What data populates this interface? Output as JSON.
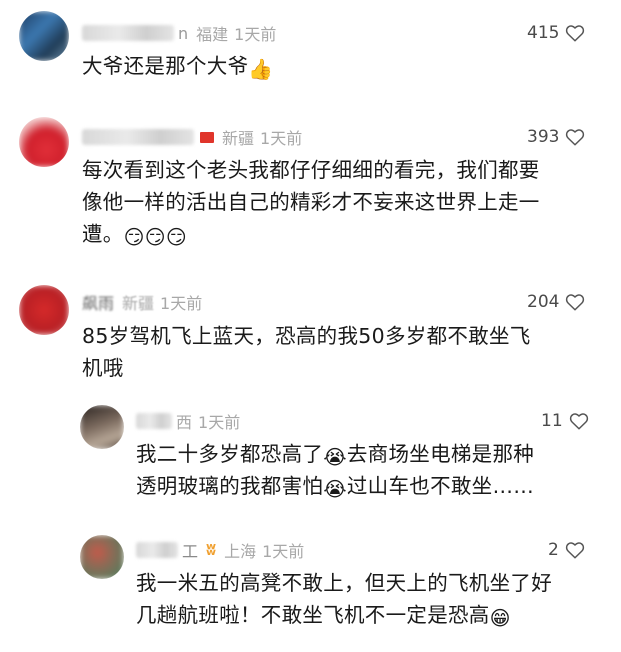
{
  "comments": [
    {
      "nickname_visible": "n",
      "location": "福建",
      "time": "1天前",
      "likes": "415",
      "text": "大爷还是那个大爷",
      "emoji": "thumbs-up-icon",
      "colors": {
        "avatar": "#2e5b8a"
      }
    },
    {
      "nickname_visible": "",
      "location": "新疆",
      "time": "1天前",
      "likes": "393",
      "text_line1": "每次看到这个老头我都仔仔细细的看完，我们都要",
      "text_line2": "像他一样的活出自己的精彩才不妄来这世界上走一",
      "text_line3": "遭。",
      "emoji": "666-smile-icon",
      "colors": {
        "avatar": "#d8313a",
        "flag": "#e0352b"
      }
    },
    {
      "nickname_visible": "飙雨",
      "location": "新疆",
      "time": "1天前",
      "likes": "204",
      "text_line1": "85岁驾机飞上蓝天，恐高的我50多岁都不敢坐飞",
      "text_line2": "机哦",
      "colors": {
        "avatar": "#c92b2b"
      }
    },
    {
      "nickname_visible": "",
      "location": "西",
      "time": "1天前",
      "likes": "11",
      "text_line1a": "我二十多岁都恐高了",
      "text_line1b": "去商场坐电梯是那种",
      "text_line2a": "透明玻璃的我都害怕",
      "text_line2b": "过山车也不敢坐……",
      "emoji": "crying-icon",
      "colors": {
        "avatar": "#6b5a4e"
      }
    },
    {
      "nickname_visible": "工",
      "location": "上海",
      "time": "1天前",
      "likes": "2",
      "text_line1": "我一米五的高凳不敢上，但天上的飞机坐了好",
      "text_line2": "几趟航班啦！不敢坐飞机不一定是恐高",
      "emoji": "grin-icon",
      "colors": {
        "avatar": "#5d7a5c"
      }
    }
  ]
}
